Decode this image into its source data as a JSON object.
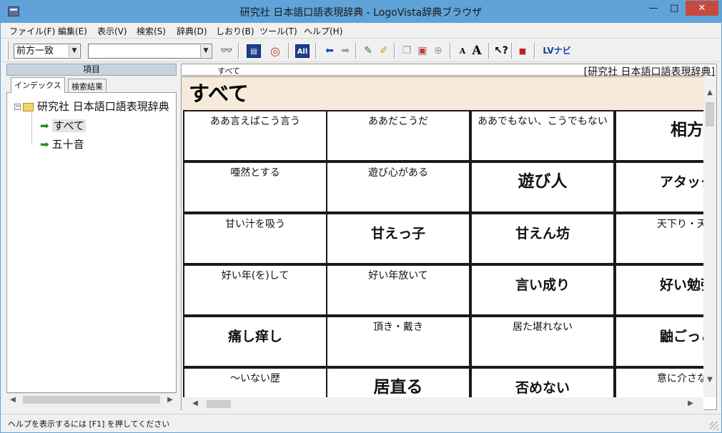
{
  "window": {
    "title": "研究社 日本語口語表現辞典 - LogoVista辞典ブラウザ",
    "minimize": "—",
    "maximize": "□",
    "close": "✕"
  },
  "menu": [
    "ファイル(F)",
    "編集(E)",
    "表示(V)",
    "検索(S)",
    "辞典(D)",
    "しおり(B)",
    "ツール(T)",
    "ヘルプ(H)"
  ],
  "toolbar": {
    "search_mode": "前方一致",
    "search_value": "",
    "all_label": "All",
    "font_small": "A",
    "font_large": "A",
    "help_label": "?",
    "lv_navi": "LVナビ"
  },
  "left_pane": {
    "header": "項目",
    "tabs": [
      "インデックス",
      "検索結果"
    ],
    "tree_root": "研究社 日本語口語表現辞典",
    "tree_children": [
      "すべて",
      "五十音"
    ]
  },
  "right_pane": {
    "breadcrumb": "すべて",
    "dictionary": "[研究社 日本語口語表現辞典]",
    "heading": "すべて",
    "rows": [
      [
        "ああ言えばこう言う",
        "ああだこうだ",
        "ああでもない、こうでもない",
        "相方"
      ],
      [
        "唖然とする",
        "遊び心がある",
        "遊び人",
        "アタック"
      ],
      [
        "甘い汁を吸う",
        "甘えっ子",
        "甘えん坊",
        "天下り・天下"
      ],
      [
        "好い年(を)して",
        "好い年放いて",
        "言い成り",
        "好い勉強"
      ],
      [
        "痛し痒し",
        "頂き・戴き",
        "居た堪れない",
        "鼬ごっこ"
      ],
      [
        "〜いない歴",
        "居直る",
        "否めない",
        "意に介さない"
      ]
    ],
    "sizes": [
      [
        "s",
        "s",
        "s",
        "l"
      ],
      [
        "s",
        "s",
        "l",
        "m"
      ],
      [
        "s",
        "m",
        "m",
        "s"
      ],
      [
        "s",
        "s",
        "m",
        "m"
      ],
      [
        "m",
        "s",
        "s",
        "m"
      ],
      [
        "s",
        "l",
        "m",
        "s"
      ]
    ]
  },
  "status": {
    "text": "ヘルプを表示するには [F1] を押してください"
  }
}
